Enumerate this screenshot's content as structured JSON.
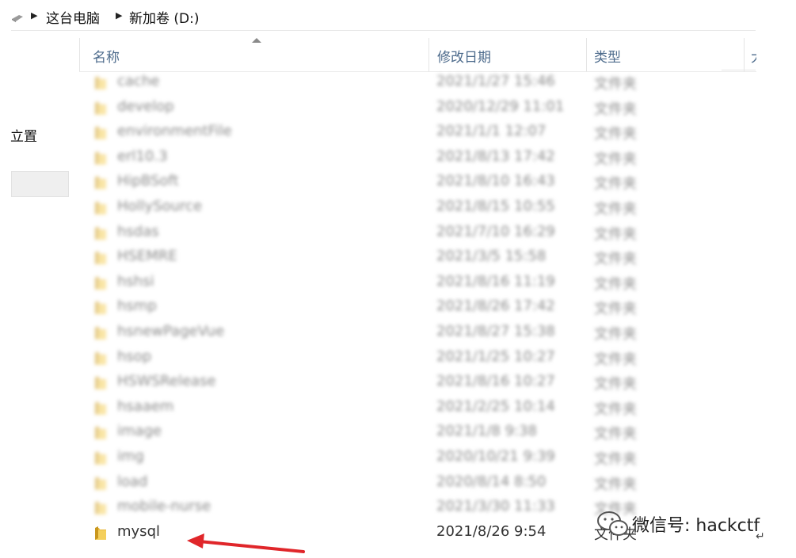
{
  "address": {
    "crumbs": [
      "这台电脑",
      "新加卷 (D:)"
    ]
  },
  "nav": {
    "position_label": "立置"
  },
  "columns": {
    "name": "名称",
    "modified": "修改日期",
    "type": "类型",
    "size_partial": "大"
  },
  "rows": [
    {
      "name": "cache",
      "date": "2021/1/27 15:46",
      "type": "文件夹"
    },
    {
      "name": "develop",
      "date": "2020/12/29 11:01",
      "type": "文件夹"
    },
    {
      "name": "environmentFile",
      "date": "2021/1/1 12:07",
      "type": "文件夹"
    },
    {
      "name": "erl10.3",
      "date": "2021/8/13 17:42",
      "type": "文件夹"
    },
    {
      "name": "HipBSoft",
      "date": "2021/8/10 16:43",
      "type": "文件夹"
    },
    {
      "name": "HollySource",
      "date": "2021/8/15 10:55",
      "type": "文件夹"
    },
    {
      "name": "hsdas",
      "date": "2021/7/10 16:29",
      "type": "文件夹"
    },
    {
      "name": "HSEMRE",
      "date": "2021/3/5 15:58",
      "type": "文件夹"
    },
    {
      "name": "hshsi",
      "date": "2021/8/16 11:19",
      "type": "文件夹"
    },
    {
      "name": "hsmp",
      "date": "2021/8/26 17:42",
      "type": "文件夹"
    },
    {
      "name": "hsnewPageVue",
      "date": "2021/8/27 15:38",
      "type": "文件夹"
    },
    {
      "name": "hsop",
      "date": "2021/1/25 10:27",
      "type": "文件夹"
    },
    {
      "name": "HSWSRelease",
      "date": "2021/8/16 10:27",
      "type": "文件夹"
    },
    {
      "name": "hsaaem",
      "date": "2021/2/25 10:14",
      "type": "文件夹"
    },
    {
      "name": "image",
      "date": "2021/1/8 9:38",
      "type": "文件夹"
    },
    {
      "name": "img",
      "date": "2020/10/21 9:39",
      "type": "文件夹"
    },
    {
      "name": "load",
      "date": "2020/8/14 8:50",
      "type": "文件夹"
    },
    {
      "name": "mobile-nurse",
      "date": "2021/3/30 11:33",
      "type": "文件夹"
    },
    {
      "name": "mysql",
      "date": "2021/8/26 9:54",
      "type": "文件夹"
    }
  ],
  "watermark": {
    "text": "微信号: hackctf"
  },
  "colors": {
    "header_text": "#4d6b8c",
    "folder": "#e8b73c",
    "arrow": "#e0262a"
  },
  "icons": [
    "drive-icon",
    "chevron-right-icon",
    "folder-icon",
    "wechat-icon"
  ]
}
